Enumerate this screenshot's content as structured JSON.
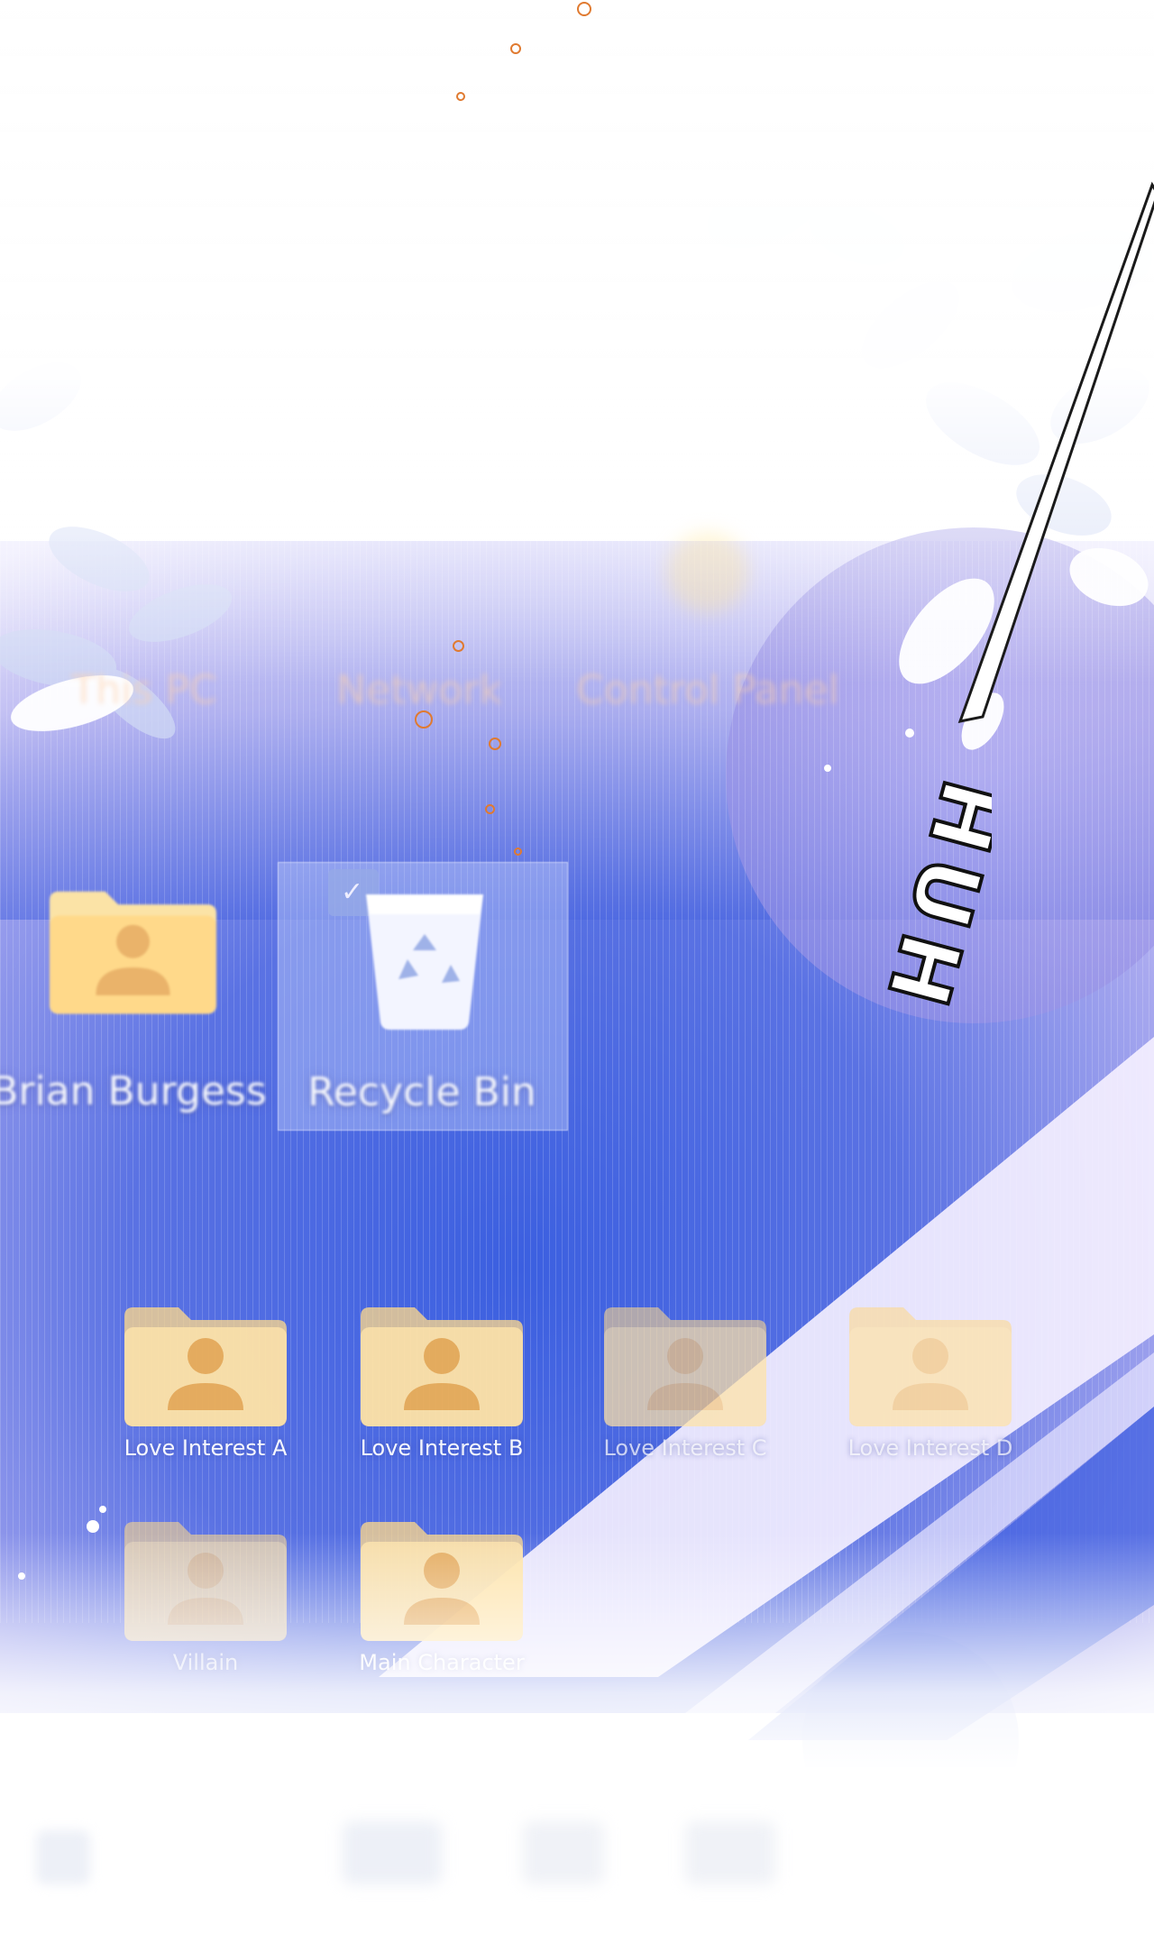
{
  "desktop": {
    "top_row": [
      {
        "label": "This PC",
        "icon": "computer-icon"
      },
      {
        "label": "Network",
        "icon": "network-icon"
      },
      {
        "label": "Control Panel",
        "icon": "control-panel-icon"
      }
    ],
    "middle_row": [
      {
        "label": "Brian Burgess",
        "icon": "user-folder-icon"
      },
      {
        "label": "Recycle Bin",
        "icon": "recycle-bin-icon",
        "selected": true
      }
    ],
    "folders": [
      {
        "label": "Love Interest A",
        "icon": "user-folder-icon"
      },
      {
        "label": "Love Interest B",
        "icon": "user-folder-icon"
      },
      {
        "label": "Love Interest C",
        "icon": "user-folder-icon"
      },
      {
        "label": "Love Interest D",
        "icon": "user-folder-icon"
      },
      {
        "label": "Villain",
        "icon": "user-folder-icon"
      },
      {
        "label": "Main Character",
        "icon": "user-folder-icon"
      }
    ]
  },
  "overlay": {
    "sfx": "HUH"
  },
  "colors": {
    "wallpaper_blue": "#2f56d8",
    "wallpaper_lavender": "#b9b4ee",
    "folder_yellow": "#ffd98a",
    "folder_person": "#e9a64a",
    "spark_orange": "#e07a30"
  }
}
